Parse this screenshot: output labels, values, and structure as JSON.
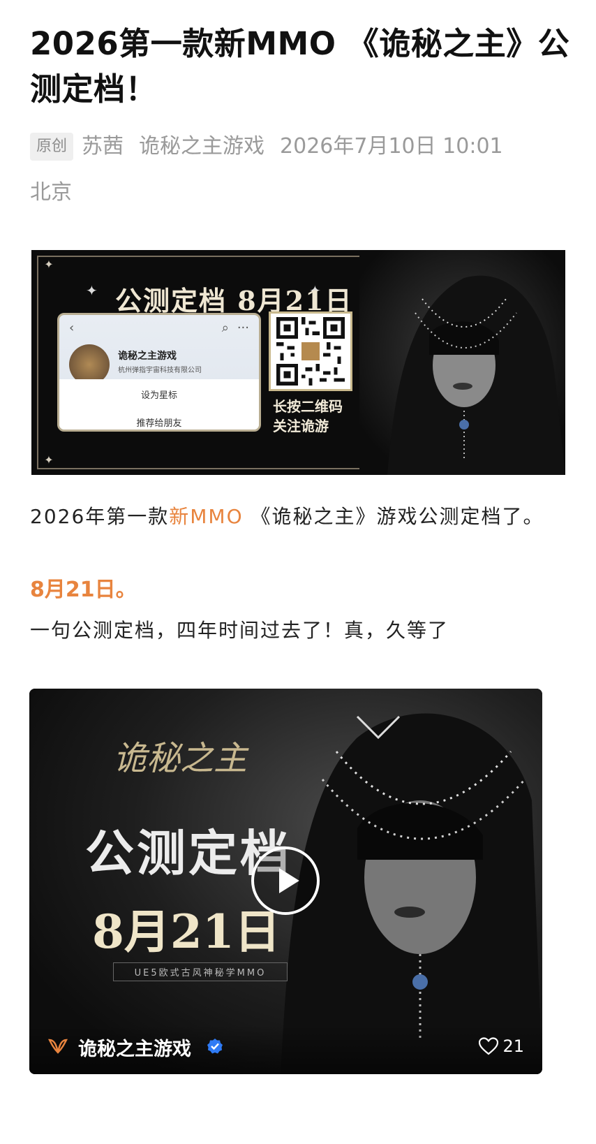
{
  "article": {
    "title": "2026第一款新MMO 《诡秘之主》公测定档！",
    "tag": "原创",
    "author": "苏茜",
    "account": "诡秘之主游戏",
    "datetime": "2026年7月10日 10:01",
    "location": "北京"
  },
  "banner": {
    "headline": "公测定档 8月21日",
    "card_account_name": "诡秘之主游戏",
    "card_company": "杭州弹指宇宙科技有限公司",
    "card_star_label": "设为星标",
    "card_recommend_label": "推荐给朋友",
    "card_back_icon": "‹",
    "card_search_icon": "⌕",
    "card_more_icon": "···",
    "qr_caption_line1": "长按二维码",
    "qr_caption_line2": "关注诡游"
  },
  "body": {
    "p1_prefix": "2026年第一款",
    "p1_highlight": "新MMO",
    "p1_suffix": " 《诡秘之主》游戏公测定档了。",
    "date_line": "8月21日。",
    "p3": "一句公测定档，四年时间过去了！真，久等了"
  },
  "video": {
    "logo_text": "诡秘之主",
    "headline": "公测定档",
    "date": "8月21日",
    "tagline": "UE5欧式古风神秘学MMO",
    "channel_name": "诡秘之主游戏",
    "like_count": "21",
    "accent_color": "#e8843e"
  }
}
